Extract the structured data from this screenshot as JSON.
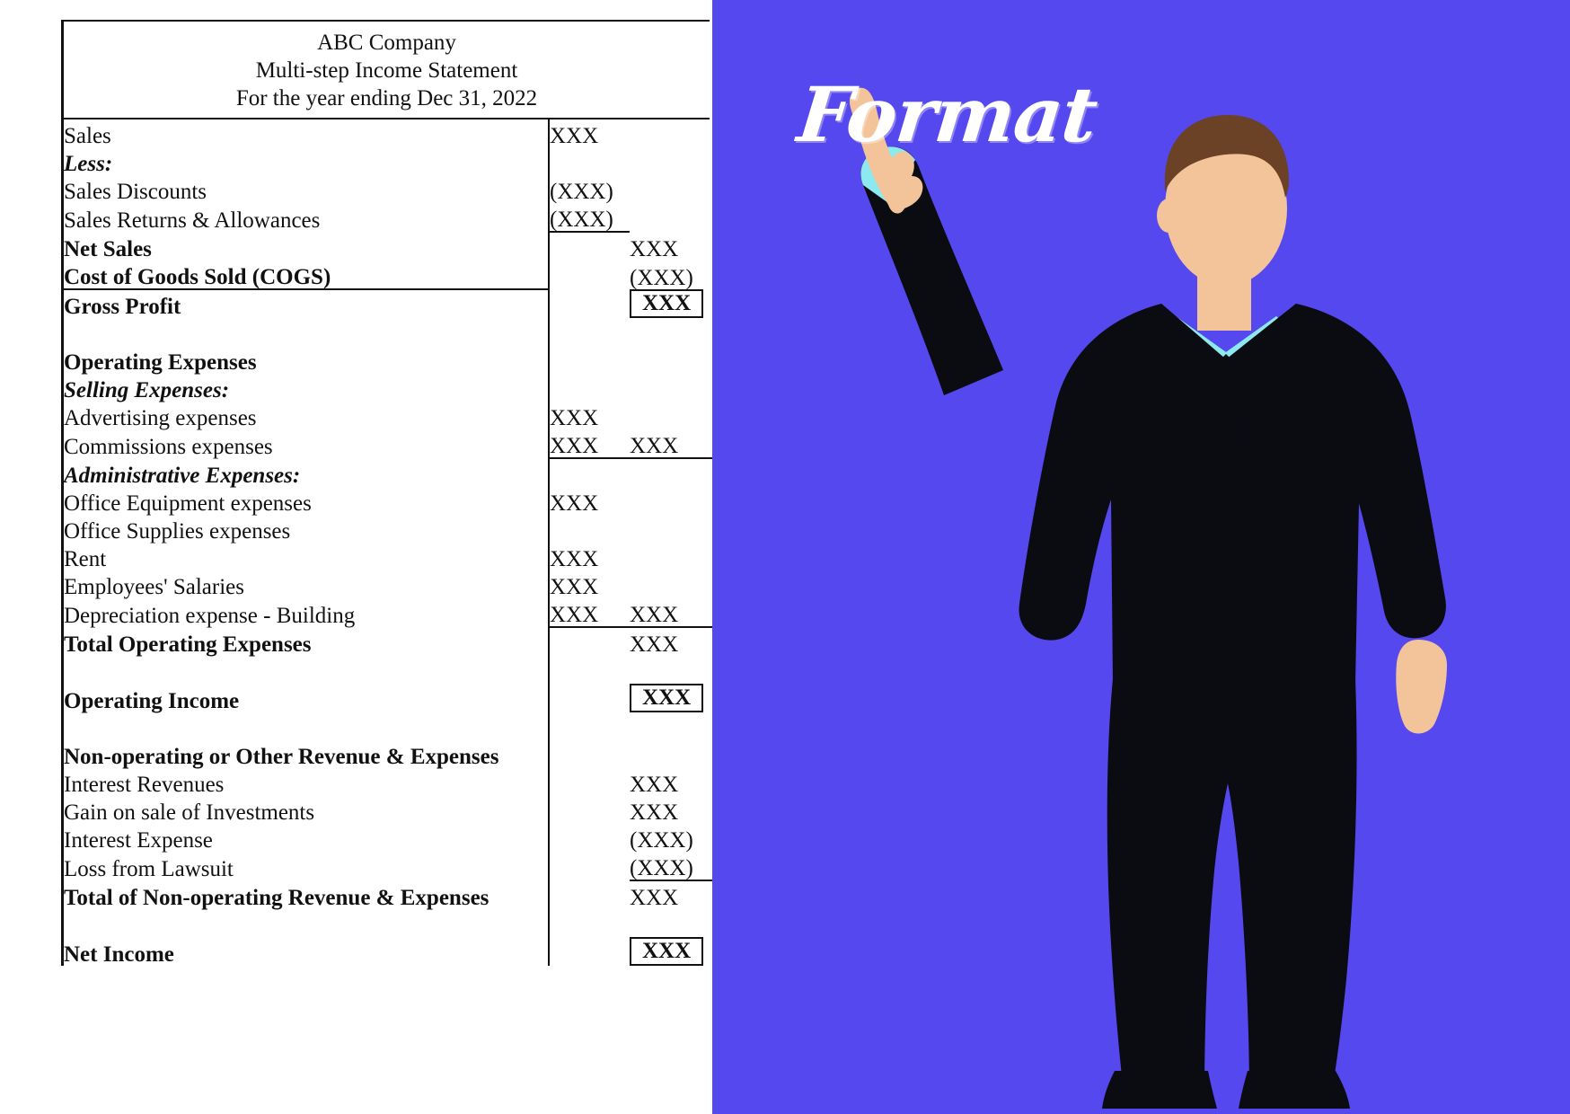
{
  "document": {
    "title_lines": [
      "ABC Company",
      "Multi-step Income Statement",
      "For the year ending Dec 31, 2022"
    ]
  },
  "rows": [
    {
      "label": "Sales",
      "style": "plain",
      "indent": 0,
      "amt1": "XXX",
      "amt2": ""
    },
    {
      "label": "Less:",
      "style": "bi",
      "indent": 1,
      "amt1": "",
      "amt2": ""
    },
    {
      "label": "Sales Discounts",
      "style": "plain",
      "indent": 2,
      "amt1": "(XXX)",
      "amt2": ""
    },
    {
      "label": "Sales Returns & Allowances",
      "style": "plain",
      "indent": 2,
      "amt1": "(XXX)",
      "amt2": ""
    },
    {
      "label": "Net Sales",
      "style": "b",
      "indent": 0,
      "amt1": "",
      "amt2": "XXX"
    },
    {
      "label": "Cost of Goods Sold (COGS)",
      "style": "b",
      "indent": 0,
      "amt1": "",
      "amt2": "(XXX)"
    },
    {
      "label": "Gross Profit",
      "style": "b",
      "indent": 0,
      "amt1": "",
      "amt2": "XXX"
    },
    {
      "label": "Operating Expenses",
      "style": "b",
      "indent": 0,
      "amt1": "",
      "amt2": ""
    },
    {
      "label": "Selling Expenses:",
      "style": "bi",
      "indent": 1,
      "amt1": "",
      "amt2": ""
    },
    {
      "label": "Advertising expenses",
      "style": "plain",
      "indent": 2,
      "amt1": "XXX",
      "amt2": ""
    },
    {
      "label": "Commissions expenses",
      "style": "plain",
      "indent": 2,
      "amt1": "XXX",
      "amt2": "XXX"
    },
    {
      "label": "Administrative Expenses:",
      "style": "bi",
      "indent": 1,
      "amt1": "",
      "amt2": ""
    },
    {
      "label": "Office Equipment expenses",
      "style": "plain",
      "indent": 2,
      "amt1": "XXX",
      "amt2": ""
    },
    {
      "label": "Office Supplies expenses",
      "style": "plain",
      "indent": 2,
      "amt1": "",
      "amt2": ""
    },
    {
      "label": "Rent",
      "style": "plain",
      "indent": 2,
      "amt1": "XXX",
      "amt2": ""
    },
    {
      "label": "Employees' Salaries",
      "style": "plain",
      "indent": 2,
      "amt1": "XXX",
      "amt2": ""
    },
    {
      "label": "Depreciation expense - Building",
      "style": "plain",
      "indent": 2,
      "amt1": "XXX",
      "amt2": "XXX"
    },
    {
      "label": "Total Operating Expenses",
      "style": "b",
      "indent": 0,
      "amt1": "",
      "amt2": "XXX"
    },
    {
      "label": "Operating Income",
      "style": "b",
      "indent": 0,
      "amt1": "",
      "amt2": "XXX"
    },
    {
      "label": "Non-operating or Other Revenue & Expenses",
      "style": "b",
      "indent": 0,
      "amt1": "",
      "amt2": ""
    },
    {
      "label": "Interest Revenues",
      "style": "plain",
      "indent": 1,
      "amt1": "",
      "amt2": "XXX"
    },
    {
      "label": "Gain on sale of Investments",
      "style": "plain",
      "indent": 1,
      "amt1": "",
      "amt2": "XXX"
    },
    {
      "label": "Interest Expense",
      "style": "plain",
      "indent": 1,
      "amt1": "",
      "amt2": "(XXX)"
    },
    {
      "label": "Loss from Lawsuit",
      "style": "plain",
      "indent": 1,
      "amt1": "",
      "amt2": "(XXX)"
    },
    {
      "label": "Total of Non-operating Revenue & Expenses",
      "style": "b",
      "indent": 0,
      "amt1": "",
      "amt2": "XXX"
    },
    {
      "label": "Net Income",
      "style": "b",
      "indent": 0,
      "amt1": "",
      "amt2": "XXX"
    }
  ],
  "illustration": {
    "caption": "Format",
    "background_color": "#5548EE",
    "suit_color": "#0b0b12",
    "shirt_color": "#8ce9f0",
    "skin_color": "#f3c49a",
    "hair_color": "#6b4226"
  }
}
